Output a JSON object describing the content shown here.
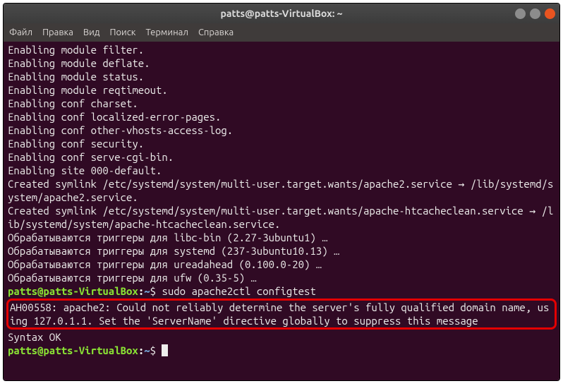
{
  "window": {
    "title": "patts@patts-VirtualBox: ~"
  },
  "menu": {
    "file": "Файл",
    "edit": "Правка",
    "view": "Вид",
    "search": "Поиск",
    "terminal": "Терминал",
    "help": "Справка"
  },
  "output": {
    "l01": "Enabling module filter.",
    "l02": "Enabling module deflate.",
    "l03": "Enabling module status.",
    "l04": "Enabling module reqtimeout.",
    "l05": "Enabling conf charset.",
    "l06": "Enabling conf localized-error-pages.",
    "l07": "Enabling conf other-vhosts-access-log.",
    "l08": "Enabling conf security.",
    "l09": "Enabling conf serve-cgi-bin.",
    "l10": "Enabling site 000-default.",
    "l11": "Created symlink /etc/systemd/system/multi-user.target.wants/apache2.service → /lib/systemd/system/apache2.service.",
    "l12": "Created symlink /etc/systemd/system/multi-user.target.wants/apache-htcacheclean.service → /lib/systemd/system/apache-htcacheclean.service.",
    "l13": "Обрабатываются триггеры для libc-bin (2.27-3ubuntu1) …",
    "l14": "Обрабатываются триггеры для systemd (237-3ubuntu10.13) …",
    "l15": "Обрабатываются триггеры для ureadahead (0.100.0-20) …",
    "l16": "Обрабатываются триггеры для ufw (0.35-5) …"
  },
  "prompt": {
    "user": "patts@patts-VirtualBox",
    "sep": ":",
    "path": "~",
    "dollar": "$"
  },
  "command1": "sudo apache2ctl configtest",
  "highlighted": {
    "msg": "AH00558: apache2: Could not reliably determine the server's fully qualified domain name, using 127.0.1.1. Set the 'ServerName' directive globally to suppress this message"
  },
  "syntax_ok": "Syntax OK"
}
